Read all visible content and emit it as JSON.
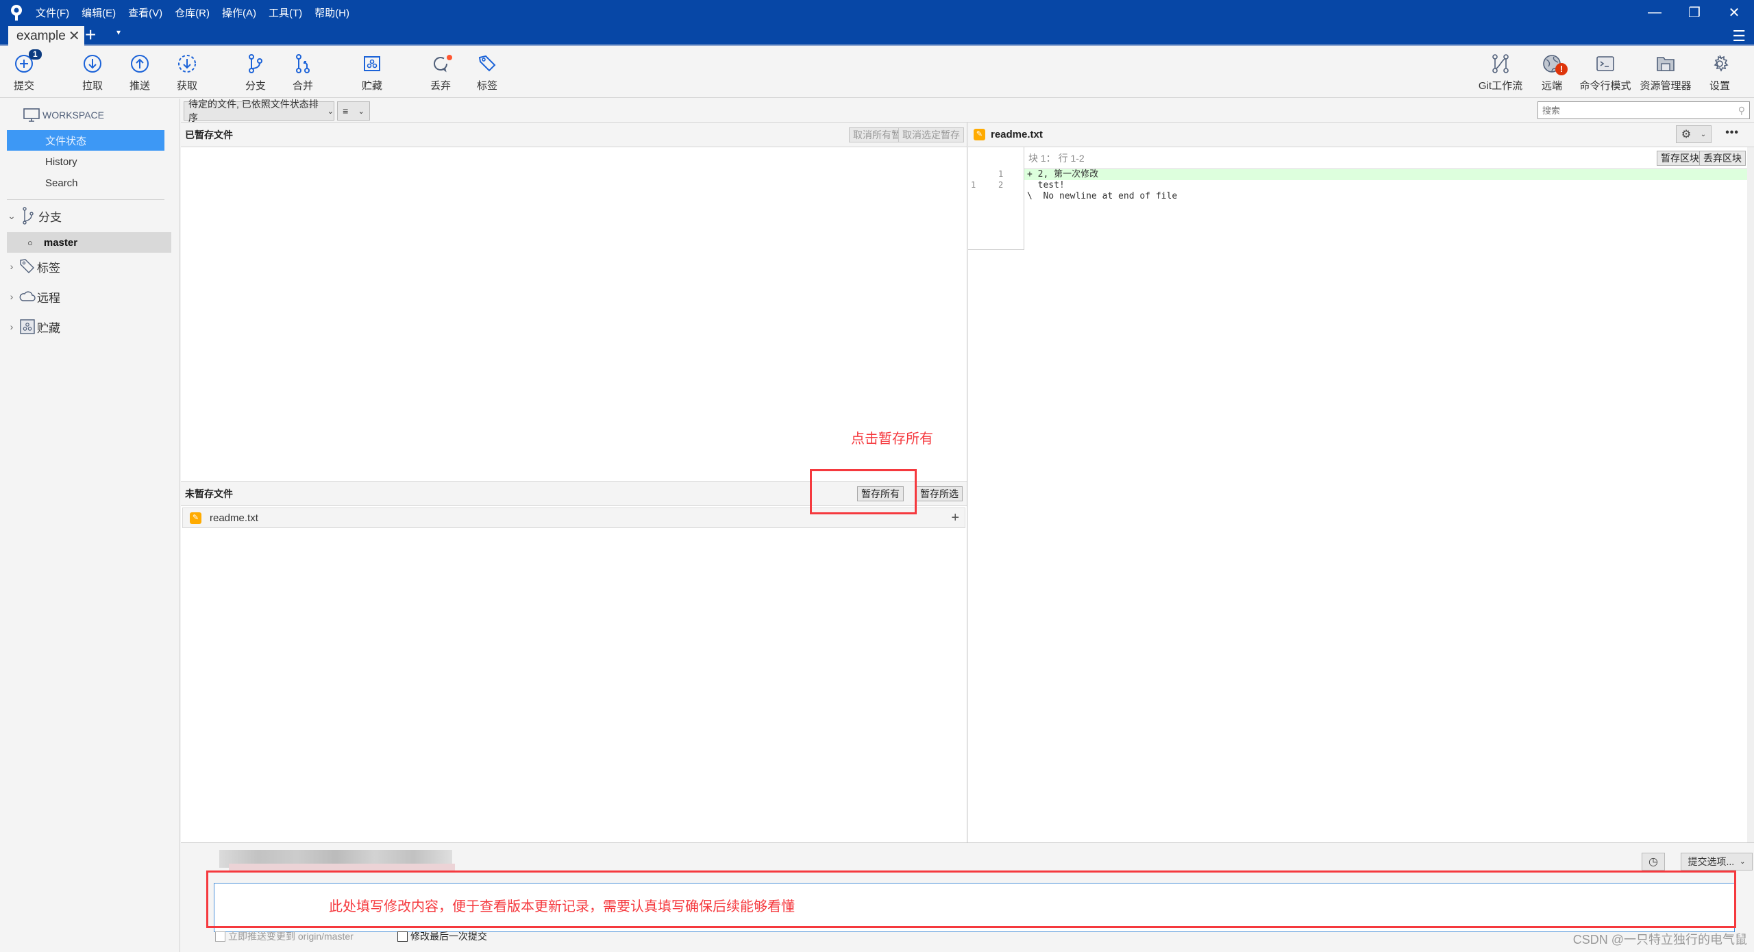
{
  "window": {
    "menu": [
      "文件(F)",
      "编辑(E)",
      "查看(V)",
      "仓库(R)",
      "操作(A)",
      "工具(T)",
      "帮助(H)"
    ],
    "controls": {
      "minimize": "—",
      "restore": "❐",
      "close": "✕"
    },
    "hamburger": "☰"
  },
  "tabs": {
    "active": "example",
    "close": "✕",
    "add": "+",
    "menu": "▾"
  },
  "toolbar": {
    "left": [
      {
        "id": "commit",
        "label": "提交",
        "icon": "plus-circle-icon",
        "badge": "1"
      },
      {
        "id": "pull",
        "label": "拉取",
        "icon": "arrow-down-circle-icon"
      },
      {
        "id": "push",
        "label": "推送",
        "icon": "arrow-up-circle-icon"
      },
      {
        "id": "fetch",
        "label": "获取",
        "icon": "fetch-dashed-circle-icon"
      },
      {
        "id": "branch",
        "label": "分支",
        "icon": "branch-icon"
      },
      {
        "id": "merge",
        "label": "合并",
        "icon": "merge-icon"
      },
      {
        "id": "stash",
        "label": "贮藏",
        "icon": "stash-icon"
      },
      {
        "id": "discard",
        "label": "丢弃",
        "icon": "discard-icon"
      },
      {
        "id": "tag",
        "label": "标签",
        "icon": "tag-icon"
      }
    ],
    "right": [
      {
        "id": "gitflow",
        "label": "Git工作流",
        "icon": "gitflow-icon"
      },
      {
        "id": "remote",
        "label": "远端",
        "icon": "globe-icon",
        "alert": "!"
      },
      {
        "id": "terminal",
        "label": "命令行模式",
        "icon": "terminal-icon"
      },
      {
        "id": "explorer",
        "label": "资源管理器",
        "icon": "folder-icon"
      },
      {
        "id": "settings",
        "label": "设置",
        "icon": "gear-icon"
      }
    ]
  },
  "sidebar": {
    "workspace": "WORKSPACE",
    "workspace_items": [
      "文件状态",
      "History",
      "Search"
    ],
    "selected_workspace": "文件状态",
    "branches_label": "分支",
    "branches": [
      "master"
    ],
    "current_branch": "master",
    "tags_label": "标签",
    "remotes_label": "远程",
    "stashes_label": "贮藏"
  },
  "filterbar": {
    "filter_value": "待定的文件, 已依照文件状态排序",
    "view_icon": "≡",
    "search_placeholder": "搜索"
  },
  "staged": {
    "title": "已暂存文件",
    "unstage_all": "取消所有暂存",
    "unstage_selected": "取消选定暂存",
    "files": []
  },
  "unstaged": {
    "title": "未暂存文件",
    "stage_all": "暂存所有",
    "stage_selected": "暂存所选",
    "files": [
      {
        "name": "readme.txt",
        "status": "modified"
      }
    ],
    "add_icon": "+"
  },
  "diff": {
    "file": "readme.txt",
    "hunk_header": "块 1： 行 1-2",
    "stage_hunk": "暂存区块",
    "discard_hunk": "丢弃区块",
    "more": "•••",
    "lines": [
      {
        "old": "",
        "new": "1",
        "text": "+ 2, 第一次修改",
        "type": "add"
      },
      {
        "old": "1",
        "new": "2",
        "text": "  test!",
        "type": "context"
      },
      {
        "old": "",
        "new": "",
        "text": "\\  No newline at end of file",
        "type": "meta"
      }
    ]
  },
  "commit": {
    "message_value": "",
    "options_label": "提交选项...",
    "push_immediately": "立即推送变更到 origin/master",
    "amend_last": "修改最后一次提交",
    "push_checked": false,
    "amend_checked": false
  },
  "annotations": {
    "stage_hint": "点击暂存所有",
    "message_hint": "此处填写修改内容，便于查看版本更新记录，需要认真填写确保后续能够看懂",
    "color": "#f5393e"
  },
  "watermark": "CSDN @一只特立独行的电气鼠"
}
